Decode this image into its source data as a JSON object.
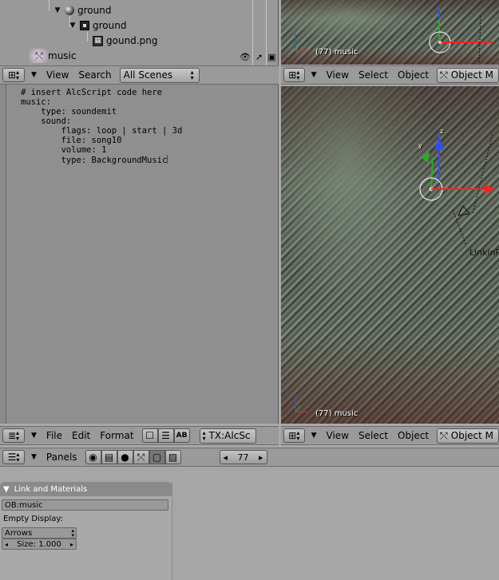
{
  "outliner": {
    "rows": [
      {
        "label": "ground"
      },
      {
        "label": "ground"
      },
      {
        "label": "gound.png"
      },
      {
        "label": "music"
      }
    ]
  },
  "outliner_header": {
    "menus": [
      "View",
      "Search"
    ],
    "scenes_dropdown": "All Scenes"
  },
  "viewport_top": {
    "frame_label": "(77) music",
    "menus": [
      "View",
      "Select",
      "Object"
    ],
    "mode_label": "Object M"
  },
  "text_editor": {
    "code_lines": [
      "# insert AlcScript code here",
      "music:",
      "    type: soundemit",
      "    sound:",
      "        flags: loop | start | 3d",
      "        file: song10",
      "        volume: 1",
      "        type: BackgroundMusic"
    ]
  },
  "viewport_main": {
    "frame_label": "(77) music",
    "object_label": "LinkinP",
    "axis_labels": [
      "z",
      "y",
      "x"
    ]
  },
  "text_header": {
    "menus": [
      "File",
      "Edit",
      "Format"
    ],
    "text_block": "TX:AlcSc"
  },
  "viewport_bottom_header": {
    "menus": [
      "View",
      "Select",
      "Object"
    ],
    "mode_label": "Object M"
  },
  "buttons_header": {
    "panels_label": "Panels",
    "frame_value": "77"
  },
  "panel": {
    "title": "Link and Materials",
    "object_field": "OB:music",
    "empty_display_label": "Empty Display:",
    "empty_display_value": "Arrows",
    "size_label": "Size: 1.000"
  }
}
